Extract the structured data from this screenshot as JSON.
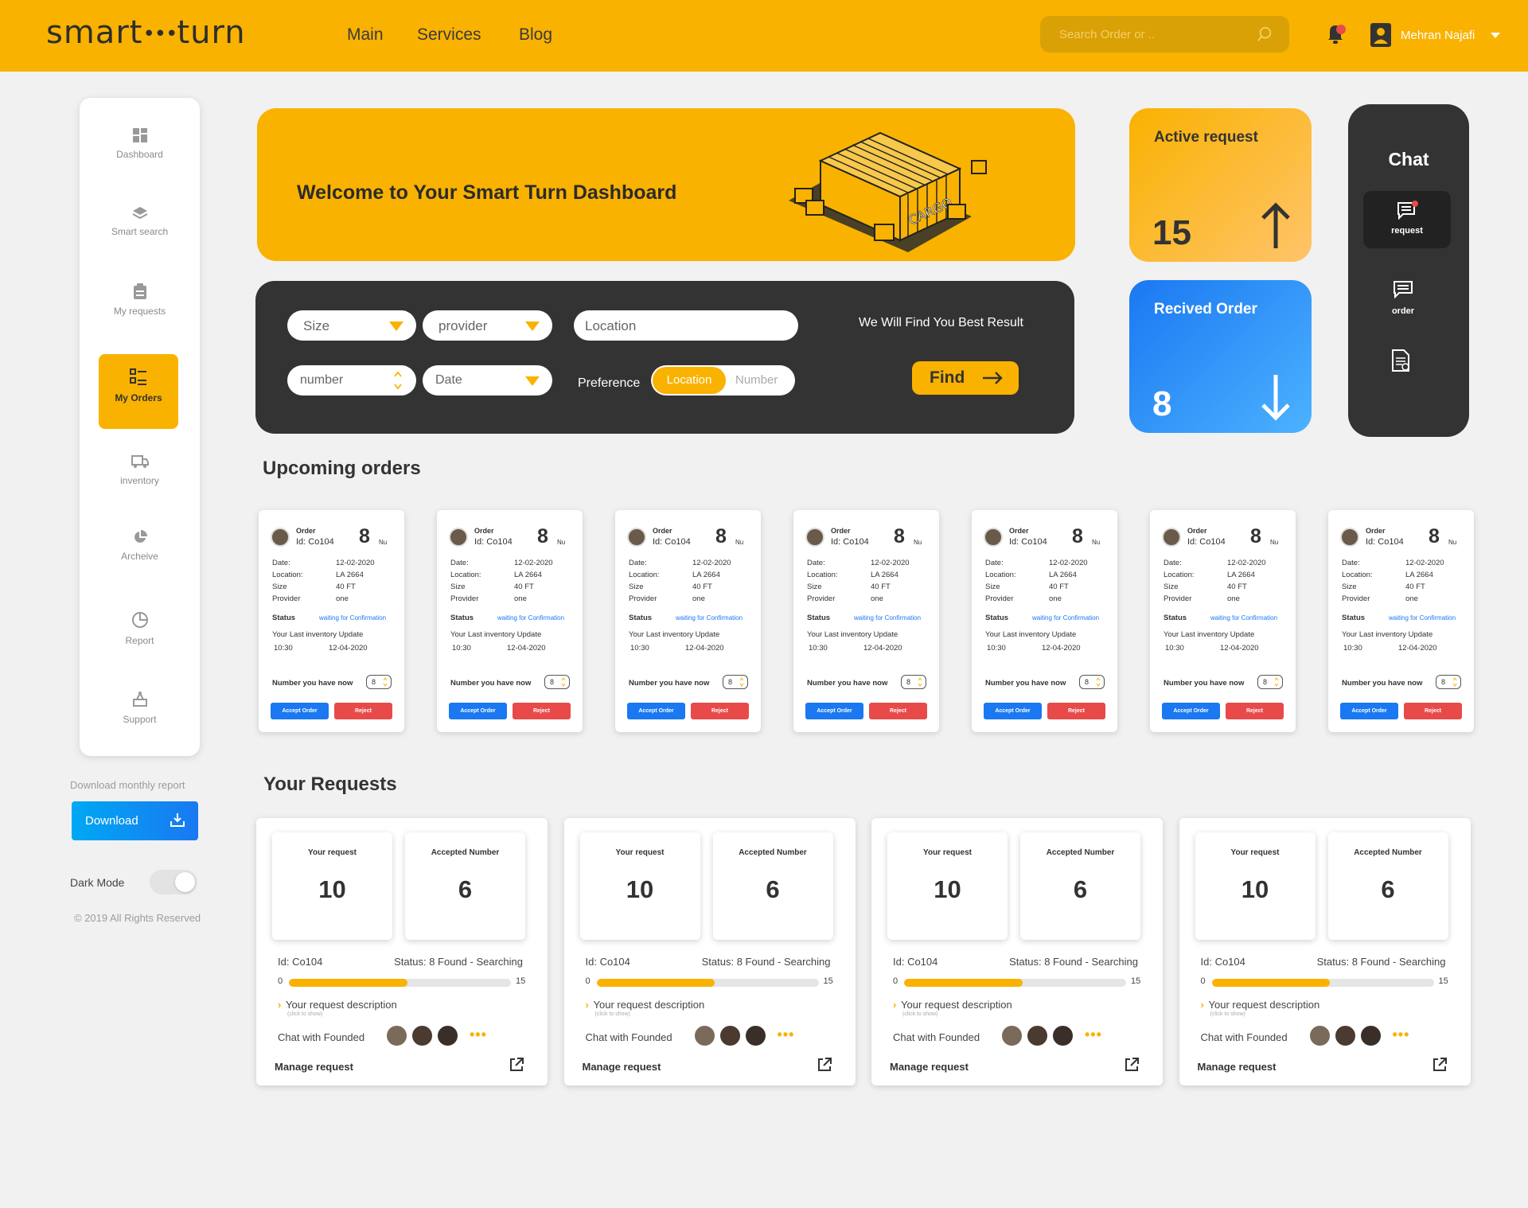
{
  "header": {
    "logo_left": "smart",
    "logo_dots": "•••",
    "logo_right": "turn",
    "nav": [
      "Main",
      "Services",
      "Blog"
    ],
    "search_placeholder": "Search Order or ..",
    "user_name": "Mehran Najafi",
    "notification_color": "#e84a4a"
  },
  "sidebar": {
    "items": [
      {
        "label": "Dashboard",
        "icon": "grid-icon"
      },
      {
        "label": "Smart search",
        "icon": "layers-icon"
      },
      {
        "label": "My requests",
        "icon": "clipboard-icon"
      },
      {
        "label": "My Orders",
        "icon": "list-icon",
        "active": true
      },
      {
        "label": "inventory",
        "icon": "truck-icon"
      },
      {
        "label": "Archeive",
        "icon": "pie-icon"
      },
      {
        "label": "Report",
        "icon": "chart-icon"
      },
      {
        "label": "Support",
        "icon": "support-icon"
      }
    ],
    "download_label": "Download monthly report",
    "download_button": "Download",
    "dark_mode_label": "Dark Mode",
    "dark_mode_on": false,
    "copyright": "© 2019 All Rights Reserved"
  },
  "welcome": {
    "title": "Welcome to Your  Smart Turn Dashboard",
    "illustration_text": "CARGO"
  },
  "search_panel": {
    "size": "Size",
    "provider": "provider",
    "location_placeholder": "Location",
    "tagline": "We Will Find You Best Result",
    "number": "number",
    "date": "Date",
    "preference_label": "Preference",
    "pref_on": "Location",
    "pref_off": "Number",
    "find": "Find"
  },
  "stats": {
    "active_title": "Active request",
    "active_value": "15",
    "received_title": "Recived Order",
    "received_value": "8"
  },
  "chat": {
    "title": "Chat",
    "request": "request",
    "order": "order"
  },
  "upcoming": {
    "title": "Upcoming orders",
    "card": {
      "order_label": "Order",
      "id": "Id: Co104",
      "count": "8",
      "unit": "Nu",
      "rows": [
        {
          "k": "Date:",
          "v": "12-02-2020"
        },
        {
          "k": "Location:",
          "v": "LA 2664"
        },
        {
          "k": "Size",
          "v": "40 FT"
        },
        {
          "k": "Provider",
          "v": "one"
        }
      ],
      "status_label": "Status",
      "status_value": "waiting for Confirmation",
      "last_update_label": "Your Last inventory Update",
      "last_time": "10:30",
      "last_date": "12-04-2020",
      "number_now_label": "Number you have now",
      "number_now": "8",
      "accept": "Accept Order",
      "reject": "Reject"
    },
    "count": 7
  },
  "requests": {
    "title": "Your Requests",
    "card": {
      "your_request_label": "Your request",
      "your_request_value": "10",
      "accepted_label": "Accepted Number",
      "accepted_value": "6",
      "id": "Id: Co104",
      "status": "Status: 8 Found - Searching",
      "min": "0",
      "max": "15",
      "progress": 0.533,
      "description": "Your request description",
      "click": "(click to show)",
      "chat_label": "Chat with Founded",
      "more": "•••",
      "manage": "Manage request"
    },
    "count": 4
  }
}
